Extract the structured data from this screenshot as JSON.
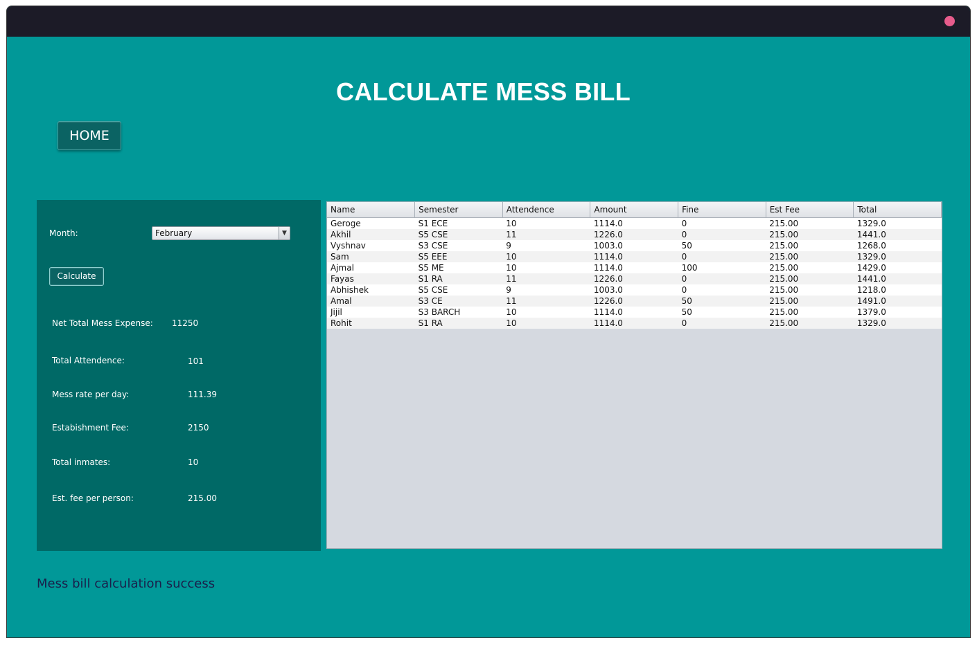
{
  "window": {
    "title": ""
  },
  "header": {
    "title": "CALCULATE MESS BILL",
    "home_label": "HOME"
  },
  "form": {
    "month_label": "Month:",
    "month_value": "February",
    "calculate_label": "Calculate"
  },
  "summary": [
    {
      "label": "Net Total Mess Expense:",
      "value": "11250"
    },
    {
      "label": "Total Attendence:",
      "value": "101"
    },
    {
      "label": "Mess rate per day:",
      "value": "111.39"
    },
    {
      "label": "Estabishment Fee:",
      "value": "2150"
    },
    {
      "label": "Total inmates:",
      "value": "10"
    },
    {
      "label": "Est. fee per person:",
      "value": "215.00"
    }
  ],
  "table": {
    "columns": [
      "Name",
      "Semester",
      "Attendence",
      "Amount",
      "Fine",
      "Est Fee",
      "Total"
    ],
    "rows": [
      [
        "Geroge",
        "S1 ECE",
        "10",
        "1114.0",
        "0",
        "215.00",
        "1329.0"
      ],
      [
        "Akhil",
        "S5 CSE",
        "11",
        "1226.0",
        "0",
        "215.00",
        "1441.0"
      ],
      [
        "Vyshnav",
        "S3 CSE",
        "9",
        "1003.0",
        "50",
        "215.00",
        "1268.0"
      ],
      [
        "Sam",
        "S5 EEE",
        "10",
        "1114.0",
        "0",
        "215.00",
        "1329.0"
      ],
      [
        "Ajmal",
        "S5 ME",
        "10",
        "1114.0",
        "100",
        "215.00",
        "1429.0"
      ],
      [
        "Fayas",
        "S1 RA",
        "11",
        "1226.0",
        "0",
        "215.00",
        "1441.0"
      ],
      [
        "Abhishek",
        "S5 CSE",
        "9",
        "1003.0",
        "0",
        "215.00",
        "1218.0"
      ],
      [
        "Amal",
        "S3 CE",
        "11",
        "1226.0",
        "50",
        "215.00",
        "1491.0"
      ],
      [
        "Jijil",
        "S3 BARCH",
        "10",
        "1114.0",
        "50",
        "215.00",
        "1379.0"
      ],
      [
        "Rohit",
        "S1 RA",
        "10",
        "1114.0",
        "0",
        "215.00",
        "1329.0"
      ]
    ]
  },
  "status": {
    "message": "Mess bill calculation success"
  },
  "colors": {
    "background": "#019898",
    "panel": "#006966",
    "titlebar": "#1c1b27",
    "close_button": "#e75c8c",
    "status_text": "#1a1f4b"
  }
}
